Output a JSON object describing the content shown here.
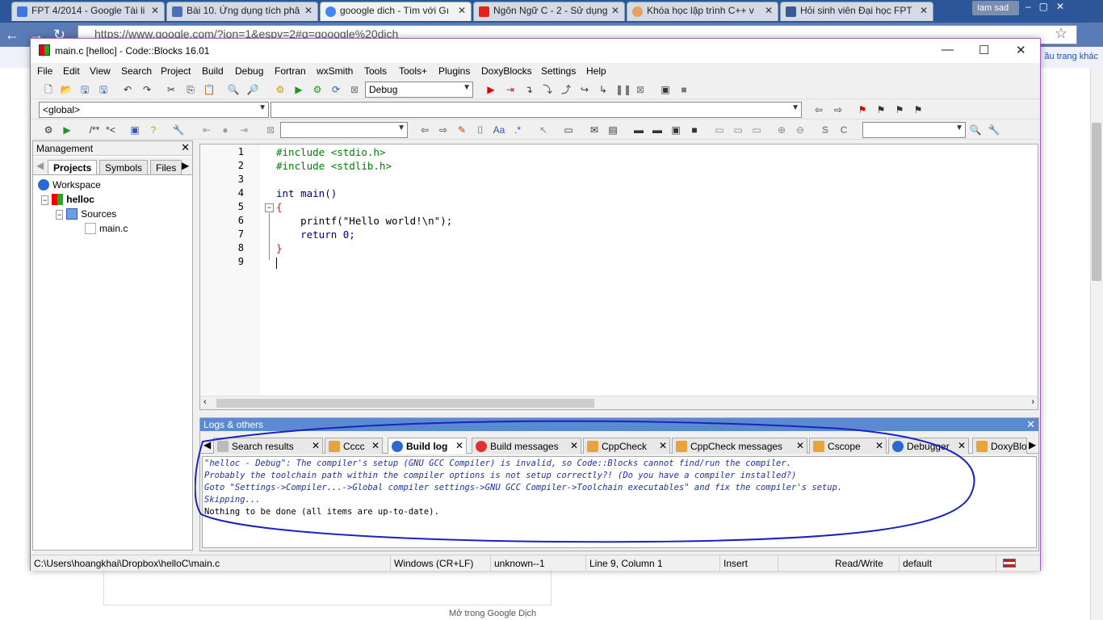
{
  "browser": {
    "tabs": [
      {
        "title": "FPT 4/2014 - Google Tài li",
        "color": "#3b78e7"
      },
      {
        "title": "Bài 10. Ứng dụng tích phâ",
        "color": "#4a6fbf"
      },
      {
        "title": "gooogle dich - Tìm với Gı",
        "color": "#4285f4"
      },
      {
        "title": "Ngôn Ngữ C - 2 - Sử dụng",
        "color": "#e62117"
      },
      {
        "title": "Khóa học lập trình C++ v",
        "color": "#e6a060"
      },
      {
        "title": "Hỏi sinh viên Đại học FPT",
        "color": "#3b5998"
      }
    ],
    "user_chip": "Iam sad",
    "url": "https://www.google.com/?ion=1&espv=2#q=gooogle%20dich",
    "bookmark_right": "ầu trang khác",
    "footer_text": "Mở trong Google Dịch"
  },
  "window": {
    "title": "main.c [helloc] - Code::Blocks 16.01"
  },
  "menu": [
    "File",
    "Edit",
    "View",
    "Search",
    "Project",
    "Build",
    "Debug",
    "Fortran",
    "wxSmith",
    "Tools",
    "Tools+",
    "Plugins",
    "DoxyBlocks",
    "Settings",
    "Help"
  ],
  "toolbar": {
    "build_target": "Debug",
    "scope": "<global>",
    "comment_tokens": [
      "/**",
      "*<"
    ]
  },
  "management": {
    "title": "Management",
    "tabs": [
      "Projects",
      "Symbols",
      "Files"
    ],
    "tree": {
      "workspace": "Workspace",
      "project": "helloc",
      "folder": "Sources",
      "file": "main.c"
    }
  },
  "editor": {
    "line_numbers": [
      "1",
      "2",
      "3",
      "4",
      "5",
      "6",
      "7",
      "8",
      "9"
    ],
    "lines": [
      "#include <stdio.h>",
      "#include <stdlib.h>",
      "",
      "int main()",
      "{",
      "    printf(\"Hello world!\\n\");",
      "    return 0;",
      "}",
      ""
    ]
  },
  "logs": {
    "title": "Logs & others",
    "tabs": [
      "Search results",
      "Cccc",
      "Build log",
      "Build messages",
      "CppCheck",
      "CppCheck messages",
      "Cscope",
      "Debugger",
      "DoxyBlo"
    ],
    "lines": [
      "\"helloc - Debug\": The compiler's setup (GNU GCC Compiler) is invalid, so Code::Blocks cannot find/run the compiler.",
      "Probably the toolchain path within the compiler options is not setup correctly?! (Do you have a compiler installed?)",
      "Goto \"Settings->Compiler...->Global compiler settings->GNU GCC Compiler->Toolchain executables\" and fix the compiler's setup.",
      "Skipping...",
      "Nothing to be done (all items are up-to-date)."
    ]
  },
  "status": {
    "path": "C:\\Users\\hoangkhai\\Dropbox\\helloC\\main.c",
    "eol": "Windows (CR+LF)",
    "encoding": "unknown--1",
    "position": "Line 9, Column 1",
    "mode": "Insert",
    "access": "Read/Write",
    "profile": "default"
  },
  "colors": {
    "keyword": "#000080",
    "preprocessor": "#008000",
    "string": "#0000ff",
    "number": "#f000f0",
    "brace": "#ff0000",
    "log_warning": "#1b2fb8",
    "annotation": "#1a22c0"
  }
}
